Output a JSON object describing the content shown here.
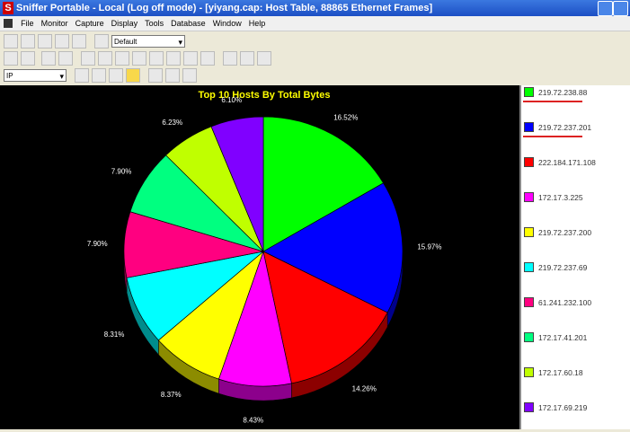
{
  "window": {
    "title": "Sniffer Portable - Local (Log off mode) - [yiyang.cap: Host Table, 88865 Ethernet Frames]",
    "logo": "S"
  },
  "menu": [
    "File",
    "Monitor",
    "Capture",
    "Display",
    "Tools",
    "Database",
    "Window",
    "Help"
  ],
  "toolbar": {
    "profile_select": "Default",
    "protocol_select": "IP"
  },
  "chart_data": {
    "type": "pie",
    "title": "Top 10 Hosts By Total Bytes",
    "categories": [
      "219.72.238.88",
      "219.72.237.201",
      "222.184.171.108",
      "172.17.3.225",
      "219.72.237.200",
      "219.72.237.69",
      "61.241.232.100",
      "172.17.41.201",
      "172.17.60.18",
      "172.17.69.219"
    ],
    "values": [
      16.52,
      15.97,
      14.26,
      8.43,
      8.37,
      8.31,
      7.9,
      7.9,
      6.23,
      6.1
    ],
    "labels": [
      "16.52%",
      "15.97%",
      "14.26%",
      "8.43%",
      "8.37%",
      "8.31%",
      "7.90%",
      "7.90%",
      "6.23%",
      "6.10%"
    ],
    "colors": [
      "#00ff00",
      "#0000ff",
      "#ff0000",
      "#ff00ff",
      "#ffff00",
      "#00ffff",
      "#ff0080",
      "#00ff80",
      "#c0ff00",
      "#8000ff"
    ],
    "legend_placement": "right",
    "highlighted": [
      "219.72.238.88",
      "219.72.237.201"
    ]
  }
}
